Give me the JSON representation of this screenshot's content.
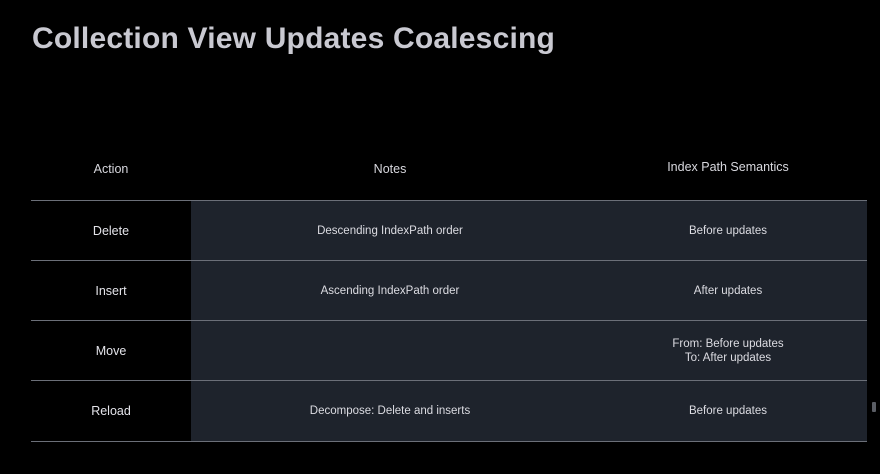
{
  "slide": {
    "title": "Collection View Updates Coalescing"
  },
  "table": {
    "headers": {
      "action": "Action",
      "notes": "Notes",
      "semantics": "Index Path Semantics"
    },
    "rows": [
      {
        "action": "Delete",
        "notes": "Descending IndexPath order",
        "semantics": [
          "Before updates"
        ]
      },
      {
        "action": "Insert",
        "notes": "Ascending IndexPath order",
        "semantics": [
          "After updates"
        ]
      },
      {
        "action": "Move",
        "notes": "",
        "semantics": [
          "From: Before updates",
          "To: After updates"
        ]
      },
      {
        "action": "Reload",
        "notes": "Decompose: Delete and inserts",
        "semantics": [
          "Before updates"
        ]
      }
    ]
  },
  "colors": {
    "background": "#000000",
    "title": "#c9c9d1",
    "row_shade": "#1e232c",
    "rule": "#6b6f78"
  }
}
